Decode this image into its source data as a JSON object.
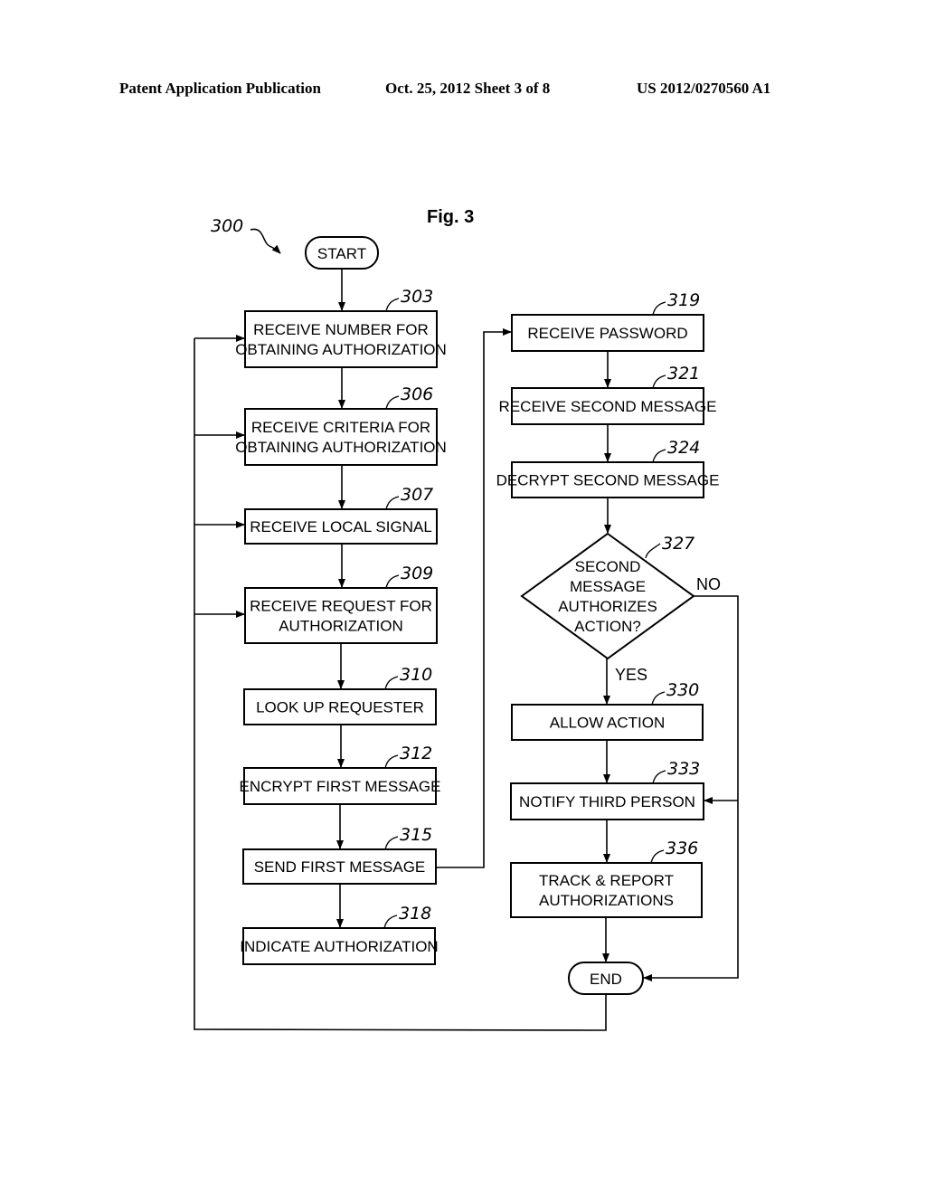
{
  "header": {
    "publication": "Patent Application Publication",
    "date_sheet": "Oct. 25, 2012   Sheet 3 of 8",
    "number": "US 2012/0270560 A1"
  },
  "figure": {
    "title": "Fig. 3",
    "ref": "300"
  },
  "terminals": {
    "start": "START",
    "end": "END"
  },
  "steps": {
    "s303": {
      "ref": "303",
      "lines": [
        "RECEIVE NUMBER FOR",
        "OBTAINING AUTHORIZATION"
      ]
    },
    "s306": {
      "ref": "306",
      "lines": [
        "RECEIVE CRITERIA FOR",
        "OBTAINING AUTHORIZATION"
      ]
    },
    "s307": {
      "ref": "307",
      "lines": [
        "RECEIVE LOCAL SIGNAL"
      ]
    },
    "s309": {
      "ref": "309",
      "lines": [
        "RECEIVE REQUEST FOR",
        "AUTHORIZATION"
      ]
    },
    "s310": {
      "ref": "310",
      "lines": [
        "LOOK UP REQUESTER"
      ]
    },
    "s312": {
      "ref": "312",
      "lines": [
        "ENCRYPT FIRST MESSAGE"
      ]
    },
    "s315": {
      "ref": "315",
      "lines": [
        "SEND FIRST MESSAGE"
      ]
    },
    "s318": {
      "ref": "318",
      "lines": [
        "INDICATE AUTHORIZATION"
      ]
    },
    "s319": {
      "ref": "319",
      "lines": [
        "RECEIVE PASSWORD"
      ]
    },
    "s321": {
      "ref": "321",
      "lines": [
        "RECEIVE SECOND MESSAGE"
      ]
    },
    "s324": {
      "ref": "324",
      "lines": [
        "DECRYPT SECOND MESSAGE"
      ]
    },
    "s330": {
      "ref": "330",
      "lines": [
        "ALLOW ACTION"
      ]
    },
    "s333": {
      "ref": "333",
      "lines": [
        "NOTIFY THIRD PERSON"
      ]
    },
    "s336": {
      "ref": "336",
      "lines": [
        "TRACK & REPORT",
        "AUTHORIZATIONS"
      ]
    }
  },
  "decision": {
    "d327": {
      "ref": "327",
      "lines": [
        "SECOND",
        "MESSAGE",
        "AUTHORIZES",
        "ACTION?"
      ],
      "yes": "YES",
      "no": "NO"
    }
  }
}
